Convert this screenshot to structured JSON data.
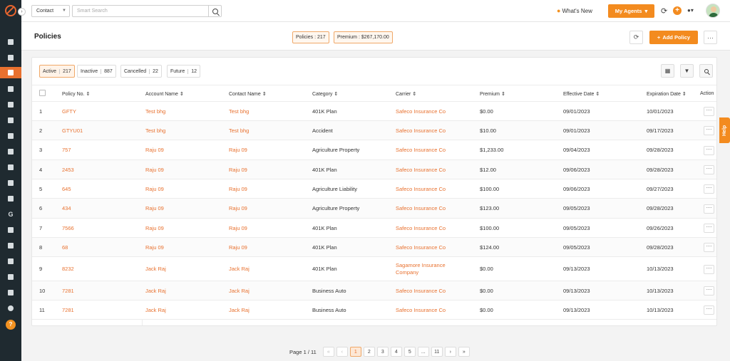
{
  "topbar": {
    "contact_select": "Contact",
    "search_placeholder": "Smart Search",
    "whats_new": "What's New",
    "my_agents": "My Agents"
  },
  "header": {
    "title": "Policies",
    "policies_pill": "Policies : 217",
    "premium_pill": "Premium : $267,170.00",
    "add_policy": "Add Policy"
  },
  "filters": [
    {
      "label": "Active",
      "count": "217"
    },
    {
      "label": "Inactive",
      "count": "887"
    },
    {
      "label": "Cancelled",
      "count": "22"
    },
    {
      "label": "Future",
      "count": "12"
    }
  ],
  "columns": [
    "Policy No.",
    "Account Name",
    "Contact Name",
    "Category",
    "Carrier",
    "Premium",
    "Effective Date",
    "Expiration Date",
    "Action"
  ],
  "rows": [
    {
      "n": "1",
      "policy": "GFTY",
      "account": "Test bhg",
      "contact": "Test bhg",
      "category": "401K Plan",
      "carrier": "Safeco Insurance Co",
      "premium": "$0.00",
      "effective": "09/01/2023",
      "expiration": "10/01/2023"
    },
    {
      "n": "2",
      "policy": "GTYU01",
      "account": "Test bhg",
      "contact": "Test bhg",
      "category": "Accident",
      "carrier": "Safeco Insurance Co",
      "premium": "$10.00",
      "effective": "09/01/2023",
      "expiration": "09/17/2023"
    },
    {
      "n": "3",
      "policy": "757",
      "account": "Raju 09",
      "contact": "Raju 09",
      "category": "Agriculture Property",
      "carrier": "Safeco Insurance Co",
      "premium": "$1,233.00",
      "effective": "09/04/2023",
      "expiration": "09/28/2023"
    },
    {
      "n": "4",
      "policy": "2453",
      "account": "Raju 09",
      "contact": "Raju 09",
      "category": "401K Plan",
      "carrier": "Safeco Insurance Co",
      "premium": "$12.00",
      "effective": "09/06/2023",
      "expiration": "09/28/2023"
    },
    {
      "n": "5",
      "policy": "645",
      "account": "Raju 09",
      "contact": "Raju 09",
      "category": "Agriculture Liability",
      "carrier": "Safeco Insurance Co",
      "premium": "$100.00",
      "effective": "09/06/2023",
      "expiration": "09/27/2023"
    },
    {
      "n": "6",
      "policy": "434",
      "account": "Raju 09",
      "contact": "Raju 09",
      "category": "Agriculture Property",
      "carrier": "Safeco Insurance Co",
      "premium": "$123.00",
      "effective": "09/05/2023",
      "expiration": "09/28/2023"
    },
    {
      "n": "7",
      "policy": "7566",
      "account": "Raju 09",
      "contact": "Raju 09",
      "category": "401K Plan",
      "carrier": "Safeco Insurance Co",
      "premium": "$100.00",
      "effective": "09/05/2023",
      "expiration": "09/26/2023"
    },
    {
      "n": "8",
      "policy": "68",
      "account": "Raju 09",
      "contact": "Raju 09",
      "category": "401K Plan",
      "carrier": "Safeco Insurance Co",
      "premium": "$124.00",
      "effective": "09/05/2023",
      "expiration": "09/28/2023"
    },
    {
      "n": "9",
      "policy": "8232",
      "account": "Jack Raj",
      "contact": "Jack Raj",
      "category": "401K Plan",
      "carrier": "Sagamore Insurance Company",
      "premium": "$0.00",
      "effective": "09/13/2023",
      "expiration": "10/13/2023"
    },
    {
      "n": "10",
      "policy": "7281",
      "account": "Jack Raj",
      "contact": "Jack Raj",
      "category": "Business Auto",
      "carrier": "Safeco Insurance Co",
      "premium": "$0.00",
      "effective": "09/13/2023",
      "expiration": "10/13/2023"
    },
    {
      "n": "11",
      "policy": "7281",
      "account": "Jack Raj",
      "contact": "Jack Raj",
      "category": "Business Auto",
      "carrier": "Safeco Insurance Co",
      "premium": "$0.00",
      "effective": "09/13/2023",
      "expiration": "10/13/2023"
    }
  ],
  "help_tab": "Help",
  "pagination": {
    "label": "Page 1 / 11",
    "pages": [
      "«",
      "‹",
      "1",
      "2",
      "3",
      "4",
      "5",
      "...",
      "11",
      "›",
      "»"
    ],
    "current": "1"
  },
  "colors": {
    "accent": "#f38b1f",
    "link": "#e8712f",
    "sidebar": "#1f2a30"
  }
}
